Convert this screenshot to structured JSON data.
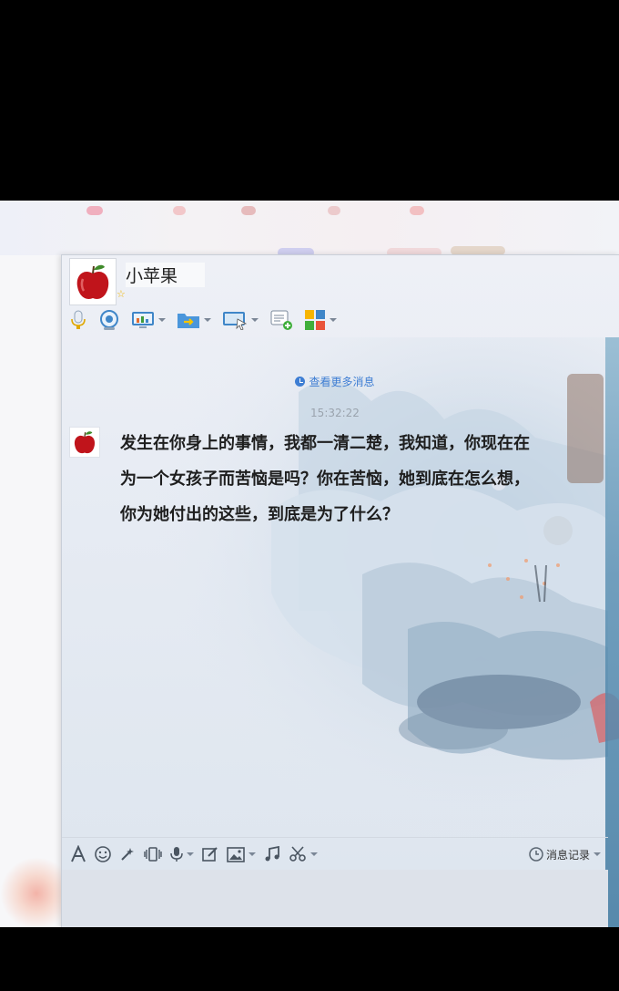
{
  "contact": {
    "name": "小苹果",
    "star_icon": "star-icon"
  },
  "toolbar": {
    "items": [
      "microphone-icon",
      "webcam-icon",
      "screen-share-icon",
      "send-file-icon",
      "remote-desktop-icon",
      "create-discussion-icon",
      "apps-icon"
    ]
  },
  "messages": {
    "more_label": "查看更多消息",
    "timestamp": "15:32:22",
    "text": "发生在你身上的事情，我都一清二楚，我知道，你现在在为一个女孩子而苦恼是吗？你在苦恼，她到底在怎么想，你为她付出的这些，到底是为了什么？"
  },
  "input_toolbar": {
    "items": [
      "font-icon",
      "emoji-icon",
      "magic-icon",
      "vibrate-icon",
      "voice-icon",
      "edit-icon",
      "image-icon",
      "music-icon",
      "screenshot-icon"
    ],
    "history_label": "消息记录"
  },
  "colors": {
    "link": "#3e7ed3",
    "window_bg": "#e6ebf3"
  }
}
